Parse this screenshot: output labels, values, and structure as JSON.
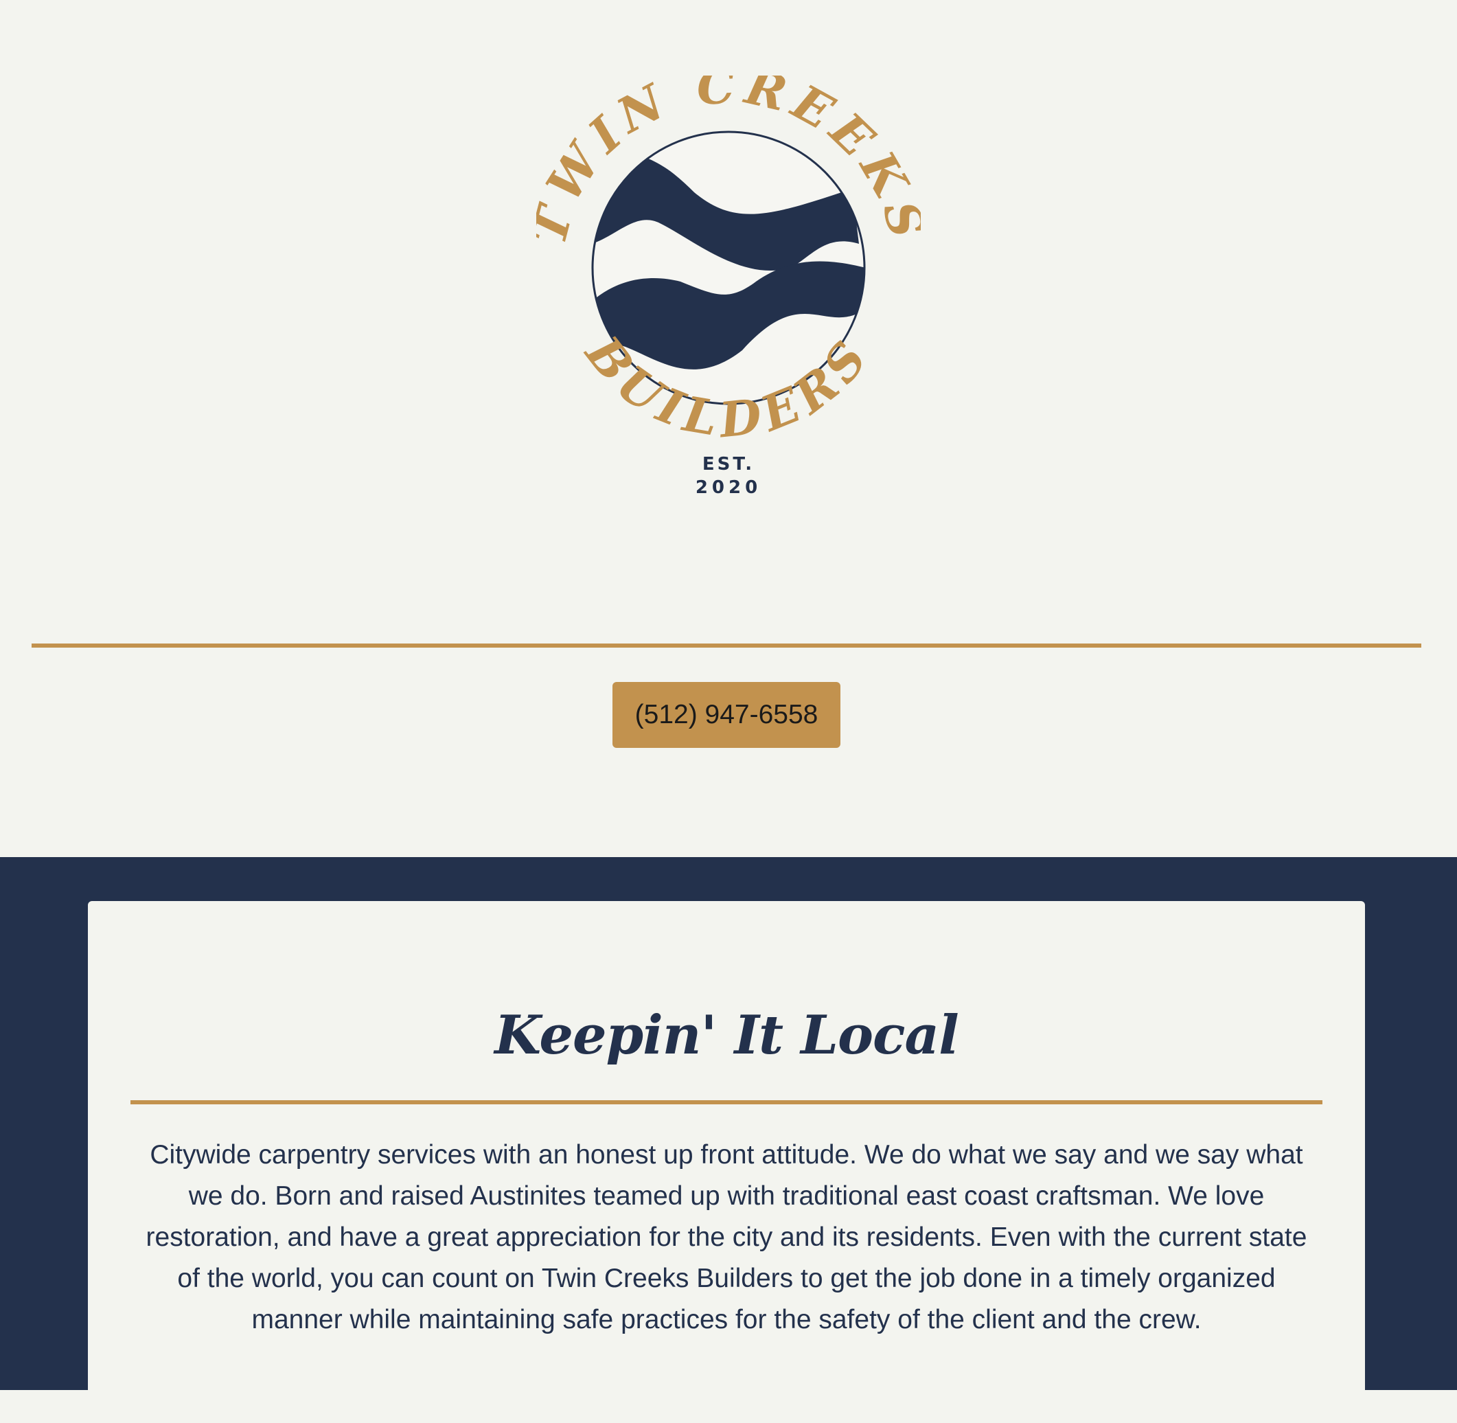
{
  "logo": {
    "top_text": "TWIN CREEKS",
    "bottom_text": "BUILDERS",
    "est_label": "EST.",
    "est_year": "2020",
    "icon": "waves-circle-icon",
    "gold_color": "#c2924e",
    "navy_color": "#23314c"
  },
  "contact": {
    "phone": "(512) 947-6558"
  },
  "section": {
    "title": "Keepin' It Local",
    "body": "Citywide carpentry services with an honest up front attitude. We do what we say and we say what we do. Born and raised Austinites teamed up with traditional east coast craftsman. We love restoration, and have a great appreciation for the city and its residents. Even with the current state of the world, you can count on Twin Creeks Builders to get the job done in a timely organized manner while maintaining safe practices for the safety of the client and the crew."
  },
  "colors": {
    "background": "#f3f4ef",
    "accent": "#c2924e",
    "navy": "#23314c"
  }
}
